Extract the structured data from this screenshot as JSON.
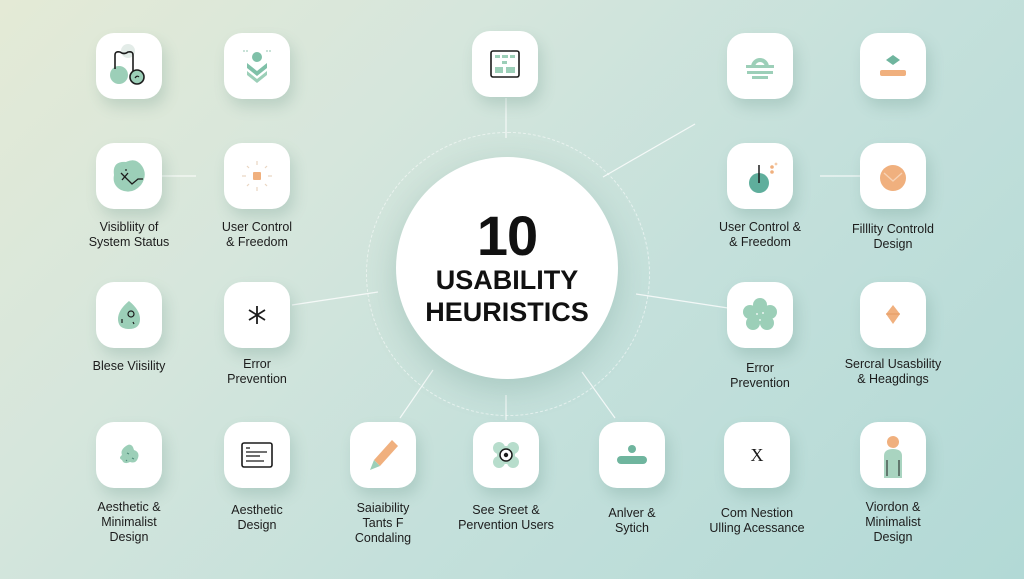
{
  "hub": {
    "number": "10",
    "line1": "USABILITY",
    "line2": "HEURISTICS"
  },
  "colors": {
    "mint": "#9ccfb8",
    "teal": "#5fae9c",
    "peach": "#f0b07e",
    "ink": "#1c1c1c"
  },
  "nodes": [
    {
      "id": "n1",
      "icon": "stethoscope-icon",
      "label": ""
    },
    {
      "id": "n2",
      "icon": "download-chevrons-icon",
      "label": ""
    },
    {
      "id": "n3",
      "icon": "layout-grid-icon",
      "label": ""
    },
    {
      "id": "n4",
      "icon": "stacked-arch-icon",
      "label": ""
    },
    {
      "id": "n5",
      "icon": "diamond-bar-icon",
      "label": ""
    },
    {
      "id": "n6",
      "icon": "blob-cross-icon",
      "label": "Visibliity of\nSystem Status"
    },
    {
      "id": "n7",
      "icon": "sun-square-icon",
      "label": "User Control\n& Freedom"
    },
    {
      "id": "n8",
      "icon": "dial-icon",
      "label": "User Control &\n& Freedom"
    },
    {
      "id": "n9",
      "icon": "envelope-circle-icon",
      "label": "Filllity Controld\nDesign"
    },
    {
      "id": "n10",
      "icon": "drop-icon",
      "label": "Blese Viisility"
    },
    {
      "id": "n11",
      "icon": "asterisk-icon",
      "label": "Error\nPrevention"
    },
    {
      "id": "n12",
      "icon": "flower-icon",
      "label": "Error\nPrevention"
    },
    {
      "id": "n13",
      "icon": "diamond-icon",
      "label": "Sercral Usasbility\n& Heagdings"
    },
    {
      "id": "n14",
      "icon": "leaf-icon",
      "label": "Aesthetic &\nMinimalist\nDesign"
    },
    {
      "id": "n15",
      "icon": "document-card-icon",
      "label": "Aesthetic\nDesign"
    },
    {
      "id": "n16",
      "icon": "pencil-icon",
      "label": "Saiaibility\nTants F\nCondaling"
    },
    {
      "id": "n17",
      "icon": "target-cross-icon",
      "label": "See Sreet &\nPervention Users"
    },
    {
      "id": "n18",
      "icon": "slider-bar-icon",
      "label": "Anlver &\nSytich"
    },
    {
      "id": "n19",
      "icon": "x-mark-icon",
      "label": "Com Nestion\nUlling Acessance"
    },
    {
      "id": "n20",
      "icon": "person-icon",
      "label": "Viordon &\nMinimalist\nDesign"
    }
  ]
}
